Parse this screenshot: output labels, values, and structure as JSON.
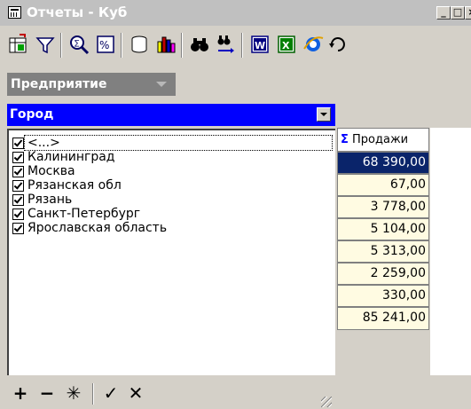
{
  "window": {
    "title": "Отчеты - Куб",
    "minimize_label": "_",
    "maximize_label": "□",
    "close_label": "×"
  },
  "toolbar": {
    "buttons": [
      {
        "icon": "cube-layout-icon"
      },
      {
        "icon": "filter-icon"
      },
      {
        "icon": "zoom-icon"
      },
      {
        "icon": "percent-icon"
      },
      {
        "icon": "database-icon"
      },
      {
        "icon": "bar-chart-icon"
      },
      {
        "icon": "binoculars-icon"
      },
      {
        "icon": "find-next-icon"
      },
      {
        "icon": "word-export-icon"
      },
      {
        "icon": "excel-export-icon"
      },
      {
        "icon": "internet-explorer-icon"
      },
      {
        "icon": "refresh-icon"
      }
    ]
  },
  "dimension_tab": {
    "label": "Предприятие"
  },
  "row_dimension": {
    "header": "Город",
    "items": [
      {
        "label": "<...>",
        "checked": true
      },
      {
        "label": "Калининград",
        "checked": true
      },
      {
        "label": "Москва",
        "checked": true
      },
      {
        "label": "Рязанская обл",
        "checked": true
      },
      {
        "label": "Рязань",
        "checked": true
      },
      {
        "label": "Санкт-Петербург",
        "checked": true
      },
      {
        "label": "Ярославская область",
        "checked": true
      }
    ]
  },
  "measure": {
    "sigma": "Σ",
    "header": "Продажи",
    "values": [
      "68 390,00",
      "67,00",
      "3 778,00",
      "5 104,00",
      "5 313,00",
      "2 259,00",
      "330,00",
      "85 241,00"
    ]
  },
  "bottom_toolbar": {
    "add": "+",
    "remove": "−",
    "all": "✳",
    "apply": "✓",
    "cancel": "✕"
  },
  "colors": {
    "header_blue": "#0000ff",
    "selected_cell": "#0a246a",
    "cell_background": "#fffbe2",
    "window_face": "#d4d0c8"
  }
}
